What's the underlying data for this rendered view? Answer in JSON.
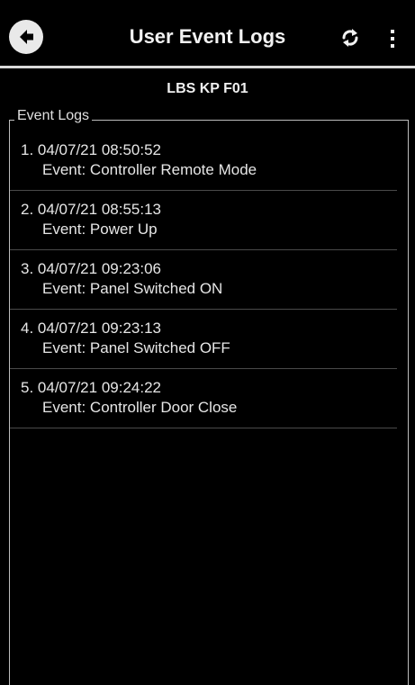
{
  "header": {
    "title": "User Event Logs",
    "back_icon": "arrow-left-circle-icon",
    "refresh_icon": "refresh-icon",
    "more_icon": "more-vertical-icon"
  },
  "device": {
    "name": "LBS KP F01"
  },
  "logs": {
    "legend": "Event Logs",
    "items": [
      {
        "index": "1.",
        "timestamp": "04/07/21 08:50:52",
        "event": "Event: Controller Remote Mode"
      },
      {
        "index": "2.",
        "timestamp": "04/07/21 08:55:13",
        "event": "Event: Power Up"
      },
      {
        "index": "3.",
        "timestamp": "04/07/21 09:23:06",
        "event": "Event: Panel Switched ON"
      },
      {
        "index": "4.",
        "timestamp": "04/07/21 09:23:13",
        "event": "Event: Panel Switched OFF"
      },
      {
        "index": "5.",
        "timestamp": "04/07/21 09:24:22",
        "event": "Event: Controller Door Close"
      }
    ]
  }
}
